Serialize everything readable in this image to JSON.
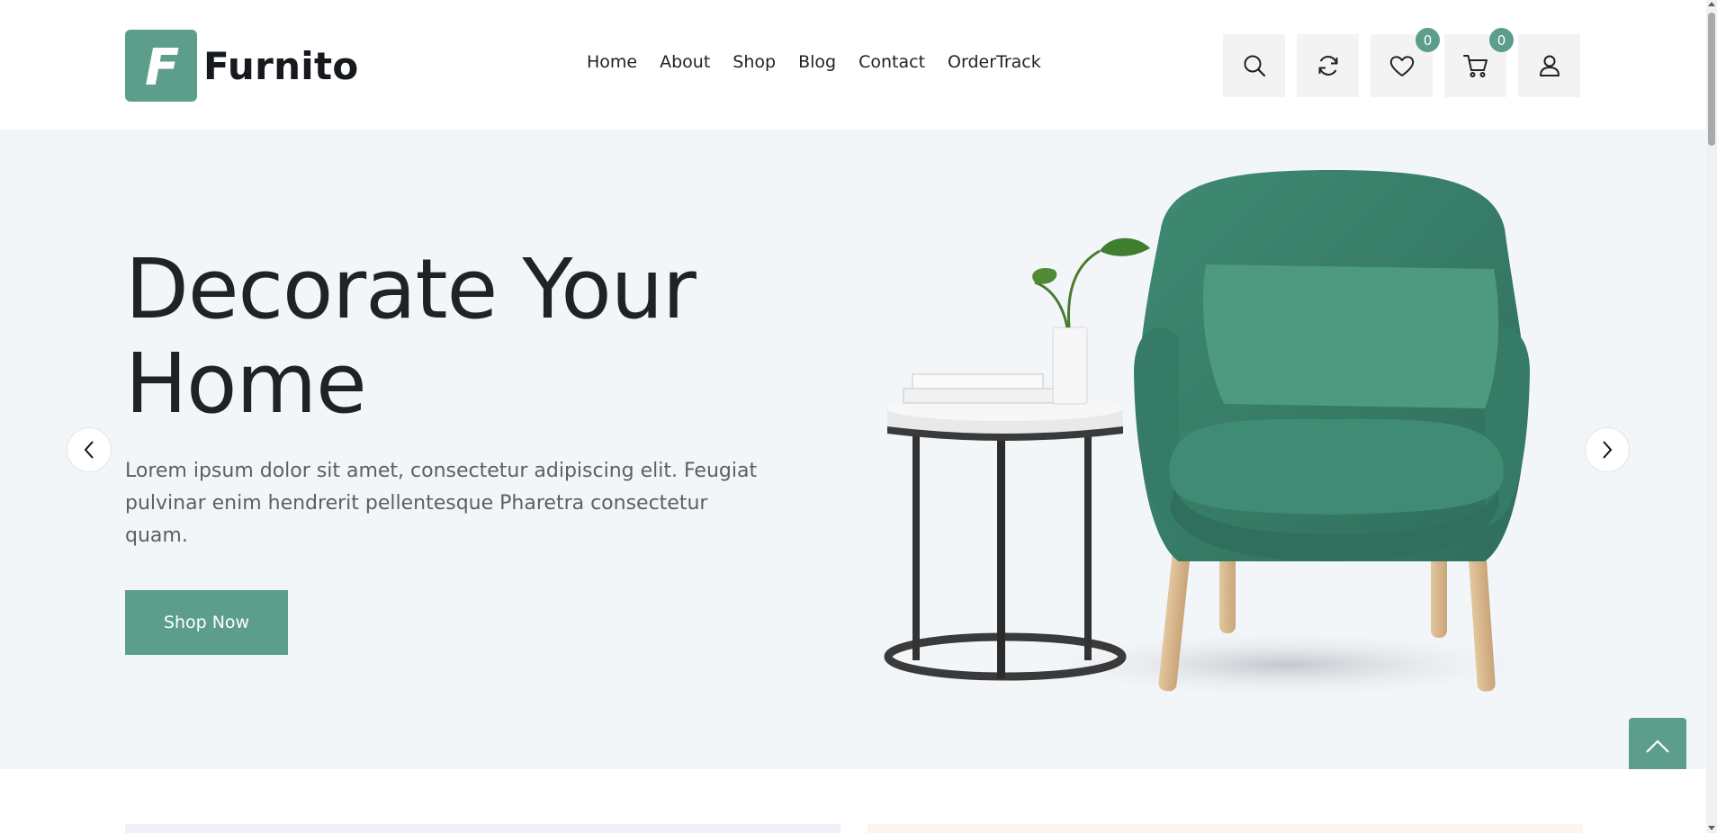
{
  "brand": {
    "name": "Furnito",
    "logo_letter": "F",
    "color": "#5c9d8c"
  },
  "nav": {
    "items": [
      "Home",
      "About",
      "Shop",
      "Blog",
      "Contact",
      "OrderTrack"
    ]
  },
  "header_icons": {
    "search": "search-icon",
    "compare": "refresh-icon",
    "wishlist": {
      "icon": "heart-icon",
      "count": "0"
    },
    "cart": {
      "icon": "cart-icon",
      "count": "0"
    },
    "account": "user-icon"
  },
  "hero": {
    "title": "Decorate Your Home",
    "subtitle": "Lorem ipsum dolor sit amet, consectetur adipiscing elit. Feugiat pulvinar enim hendrerit pellentesque Pharetra consectetur quam.",
    "button": "Shop Now",
    "background": "#f3f6f9"
  },
  "controls": {
    "prev": "chevron-left-icon",
    "next": "chevron-right-icon",
    "to_top": "chevron-up-icon"
  }
}
